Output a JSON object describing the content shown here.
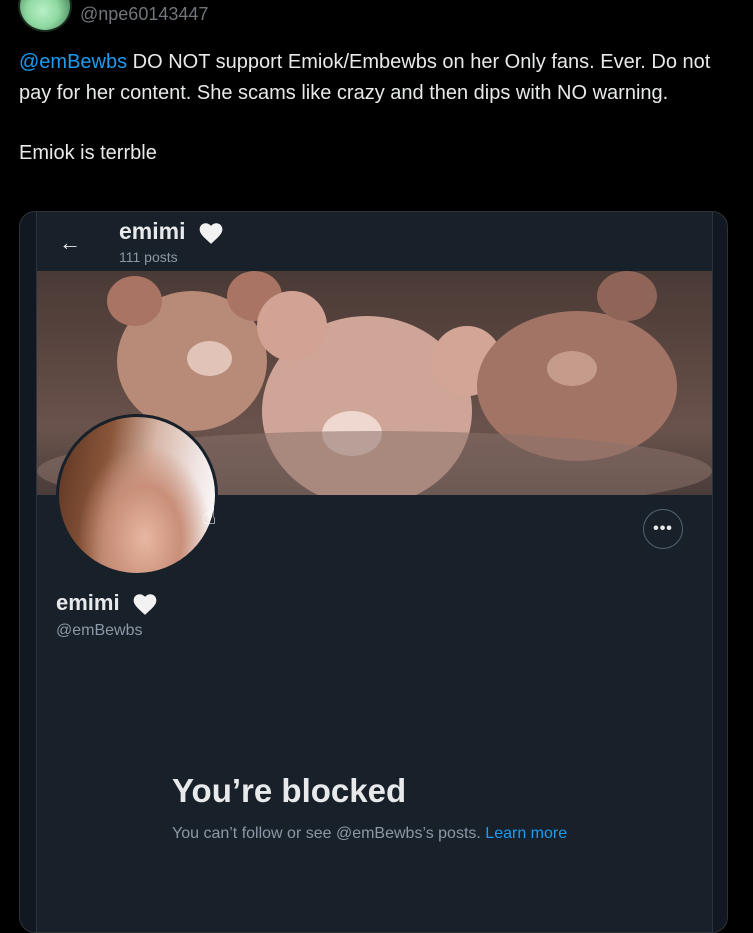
{
  "tweet": {
    "author_handle": "@npe60143447",
    "mention": "@emBewbs",
    "body_line1": " DO NOT support Emiok/Embewbs on her Only fans. Ever. Do not pay for her content. She scams like crazy and then dips with NO warning.",
    "body_line2": "Emiok is terrble"
  },
  "embedded_profile": {
    "header_name": "emimi",
    "header_posts": "111 posts",
    "display_name": "emimi",
    "handle": "@emBewbs",
    "more_label": "•••",
    "blocked_title": "You’re blocked",
    "blocked_desc": "You can’t follow or see @emBewbs’s posts. ",
    "learn_more": "Learn more"
  },
  "colors": {
    "background": "#000000",
    "text": "#e7e9ea",
    "muted": "#71767b",
    "link": "#1d9bf0",
    "profile_bg": "#18202a"
  },
  "icons": {
    "back": "arrow-left-icon",
    "heart": "white-heart-icon",
    "more": "more-horizontal-icon",
    "cursor": "hand-pointer-icon"
  }
}
